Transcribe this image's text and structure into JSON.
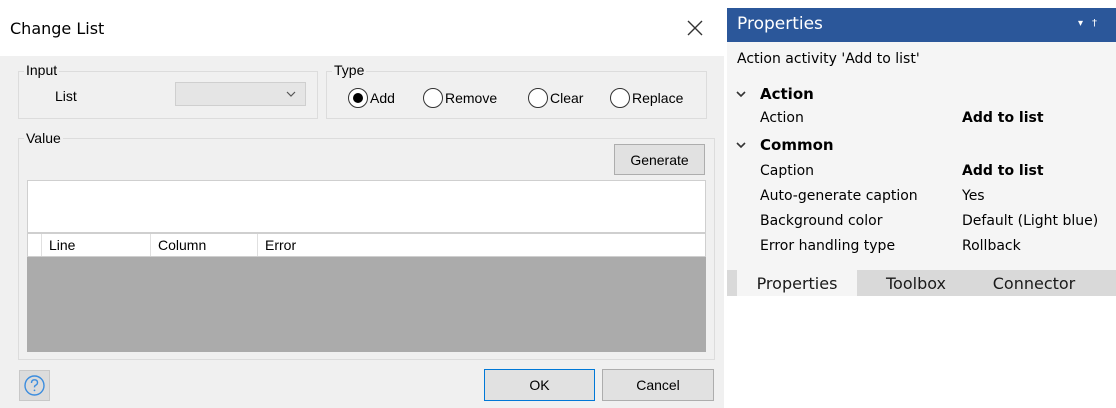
{
  "dialog": {
    "title": "Change List",
    "input_group": {
      "legend": "Input",
      "list_label": "List",
      "list_value": ""
    },
    "type_group": {
      "legend": "Type",
      "options": [
        {
          "label": "Add",
          "checked": true
        },
        {
          "label": "Remove",
          "checked": false
        },
        {
          "label": "Clear",
          "checked": false
        },
        {
          "label": "Replace",
          "checked": false
        }
      ]
    },
    "value_group": {
      "legend": "Value",
      "generate_label": "Generate"
    },
    "grid": {
      "columns": [
        "Line",
        "Column",
        "Error"
      ]
    },
    "ok_label": "OK",
    "cancel_label": "Cancel",
    "help_icon": "question-circle-icon"
  },
  "properties": {
    "title": "Properties",
    "subtitle": "Action activity 'Add to list'",
    "categories": [
      {
        "name": "Action",
        "rows": [
          {
            "name": "Action",
            "value": "Add to list",
            "bold": true
          }
        ]
      },
      {
        "name": "Common",
        "rows": [
          {
            "name": "Caption",
            "value": "Add to list",
            "bold": true
          },
          {
            "name": "Auto-generate caption",
            "value": "Yes",
            "bold": false
          },
          {
            "name": "Background color",
            "value": "Default (Light blue)",
            "bold": false
          },
          {
            "name": "Error handling type",
            "value": "Rollback",
            "bold": false
          }
        ]
      }
    ],
    "tabs": [
      {
        "label": "Properties",
        "active": true
      },
      {
        "label": "Toolbox",
        "active": false
      },
      {
        "label": "Connector",
        "active": false
      }
    ]
  },
  "colors": {
    "panel_header": "#2b579a",
    "help_icon": "#3c8dde",
    "default_button_border": "#0078d7"
  }
}
